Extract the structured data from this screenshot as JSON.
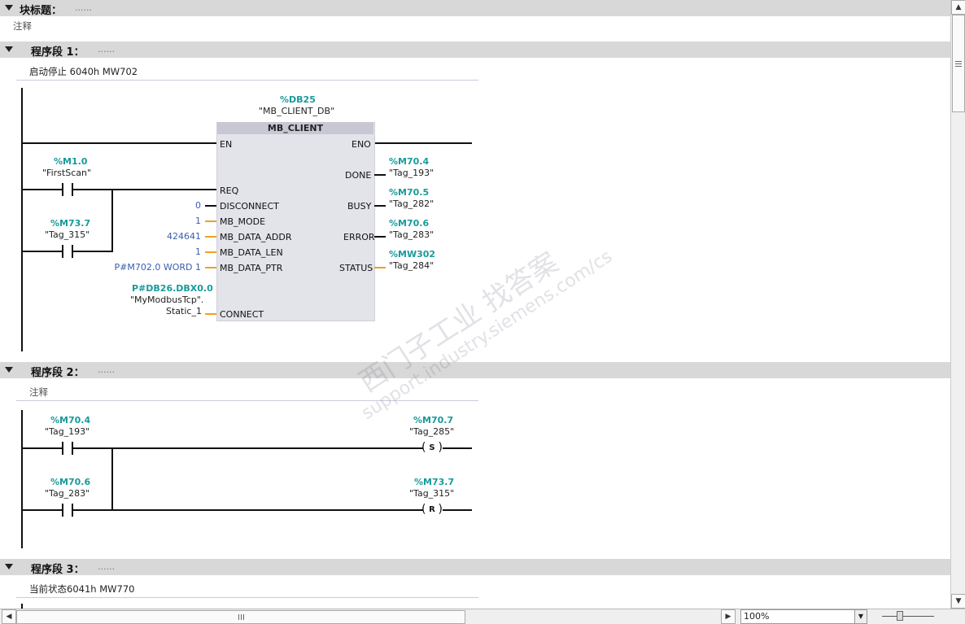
{
  "block": {
    "title": "块标题：",
    "dots": "......",
    "comment": "注释"
  },
  "network1": {
    "title": "程序段 1：",
    "dots": "......",
    "comment": "启动停止 6040h   MW702",
    "db_addr": "%DB25",
    "db_name": "\"MB_CLIENT_DB\"",
    "fb_name": "MB_CLIENT",
    "pins_left": [
      "EN",
      "REQ",
      "DISCONNECT",
      "MB_MODE",
      "MB_DATA_ADDR",
      "MB_DATA_LEN",
      "MB_DATA_PTR",
      "CONNECT"
    ],
    "pins_right": [
      "ENO",
      "DONE",
      "BUSY",
      "ERROR",
      "STATUS"
    ],
    "contact1_addr": "%M1.0",
    "contact1_tag": "\"FirstScan\"",
    "contact2_addr": "%M73.7",
    "contact2_tag": "\"Tag_315\"",
    "in_disconnect": "0",
    "in_mode": "1",
    "in_addr": "424641",
    "in_len": "1",
    "in_ptr": "P#M702.0 WORD 1",
    "in_connect_addr": "P#DB26.DBX0.0",
    "in_connect_tag1": "\"MyModbusTcp\".",
    "in_connect_tag2": "Static_1",
    "out_done_addr": "%M70.4",
    "out_done_tag": "\"Tag_193\"",
    "out_busy_addr": "%M70.5",
    "out_busy_tag": "\"Tag_282\"",
    "out_error_addr": "%M70.6",
    "out_error_tag": "\"Tag_283\"",
    "out_status_addr": "%MW302",
    "out_status_tag": "\"Tag_284\""
  },
  "network2": {
    "title": "程序段 2：",
    "dots": "......",
    "comment": "注释",
    "c1_addr": "%M70.4",
    "c1_tag": "\"Tag_193\"",
    "c2_addr": "%M70.6",
    "c2_tag": "\"Tag_283\"",
    "coil1_addr": "%M70.7",
    "coil1_tag": "\"Tag_285\"",
    "coil1_type": "S",
    "coil2_addr": "%M73.7",
    "coil2_tag": "\"Tag_315\"",
    "coil2_type": "R"
  },
  "network3": {
    "title": "程序段 3：",
    "dots": "......",
    "comment": "当前状态6041h      MW770"
  },
  "watermark": {
    "line1": "西门子工业   找答案",
    "line2": "support.industry.siemens.com/cs"
  },
  "statusbar": {
    "zoom": "100%"
  },
  "icons": {
    "collapse": "triangle-down-icon",
    "scroll_up": "arrow-up-icon",
    "scroll_down": "arrow-down-icon",
    "scroll_left": "arrow-left-icon",
    "scroll_right": "arrow-right-icon"
  }
}
